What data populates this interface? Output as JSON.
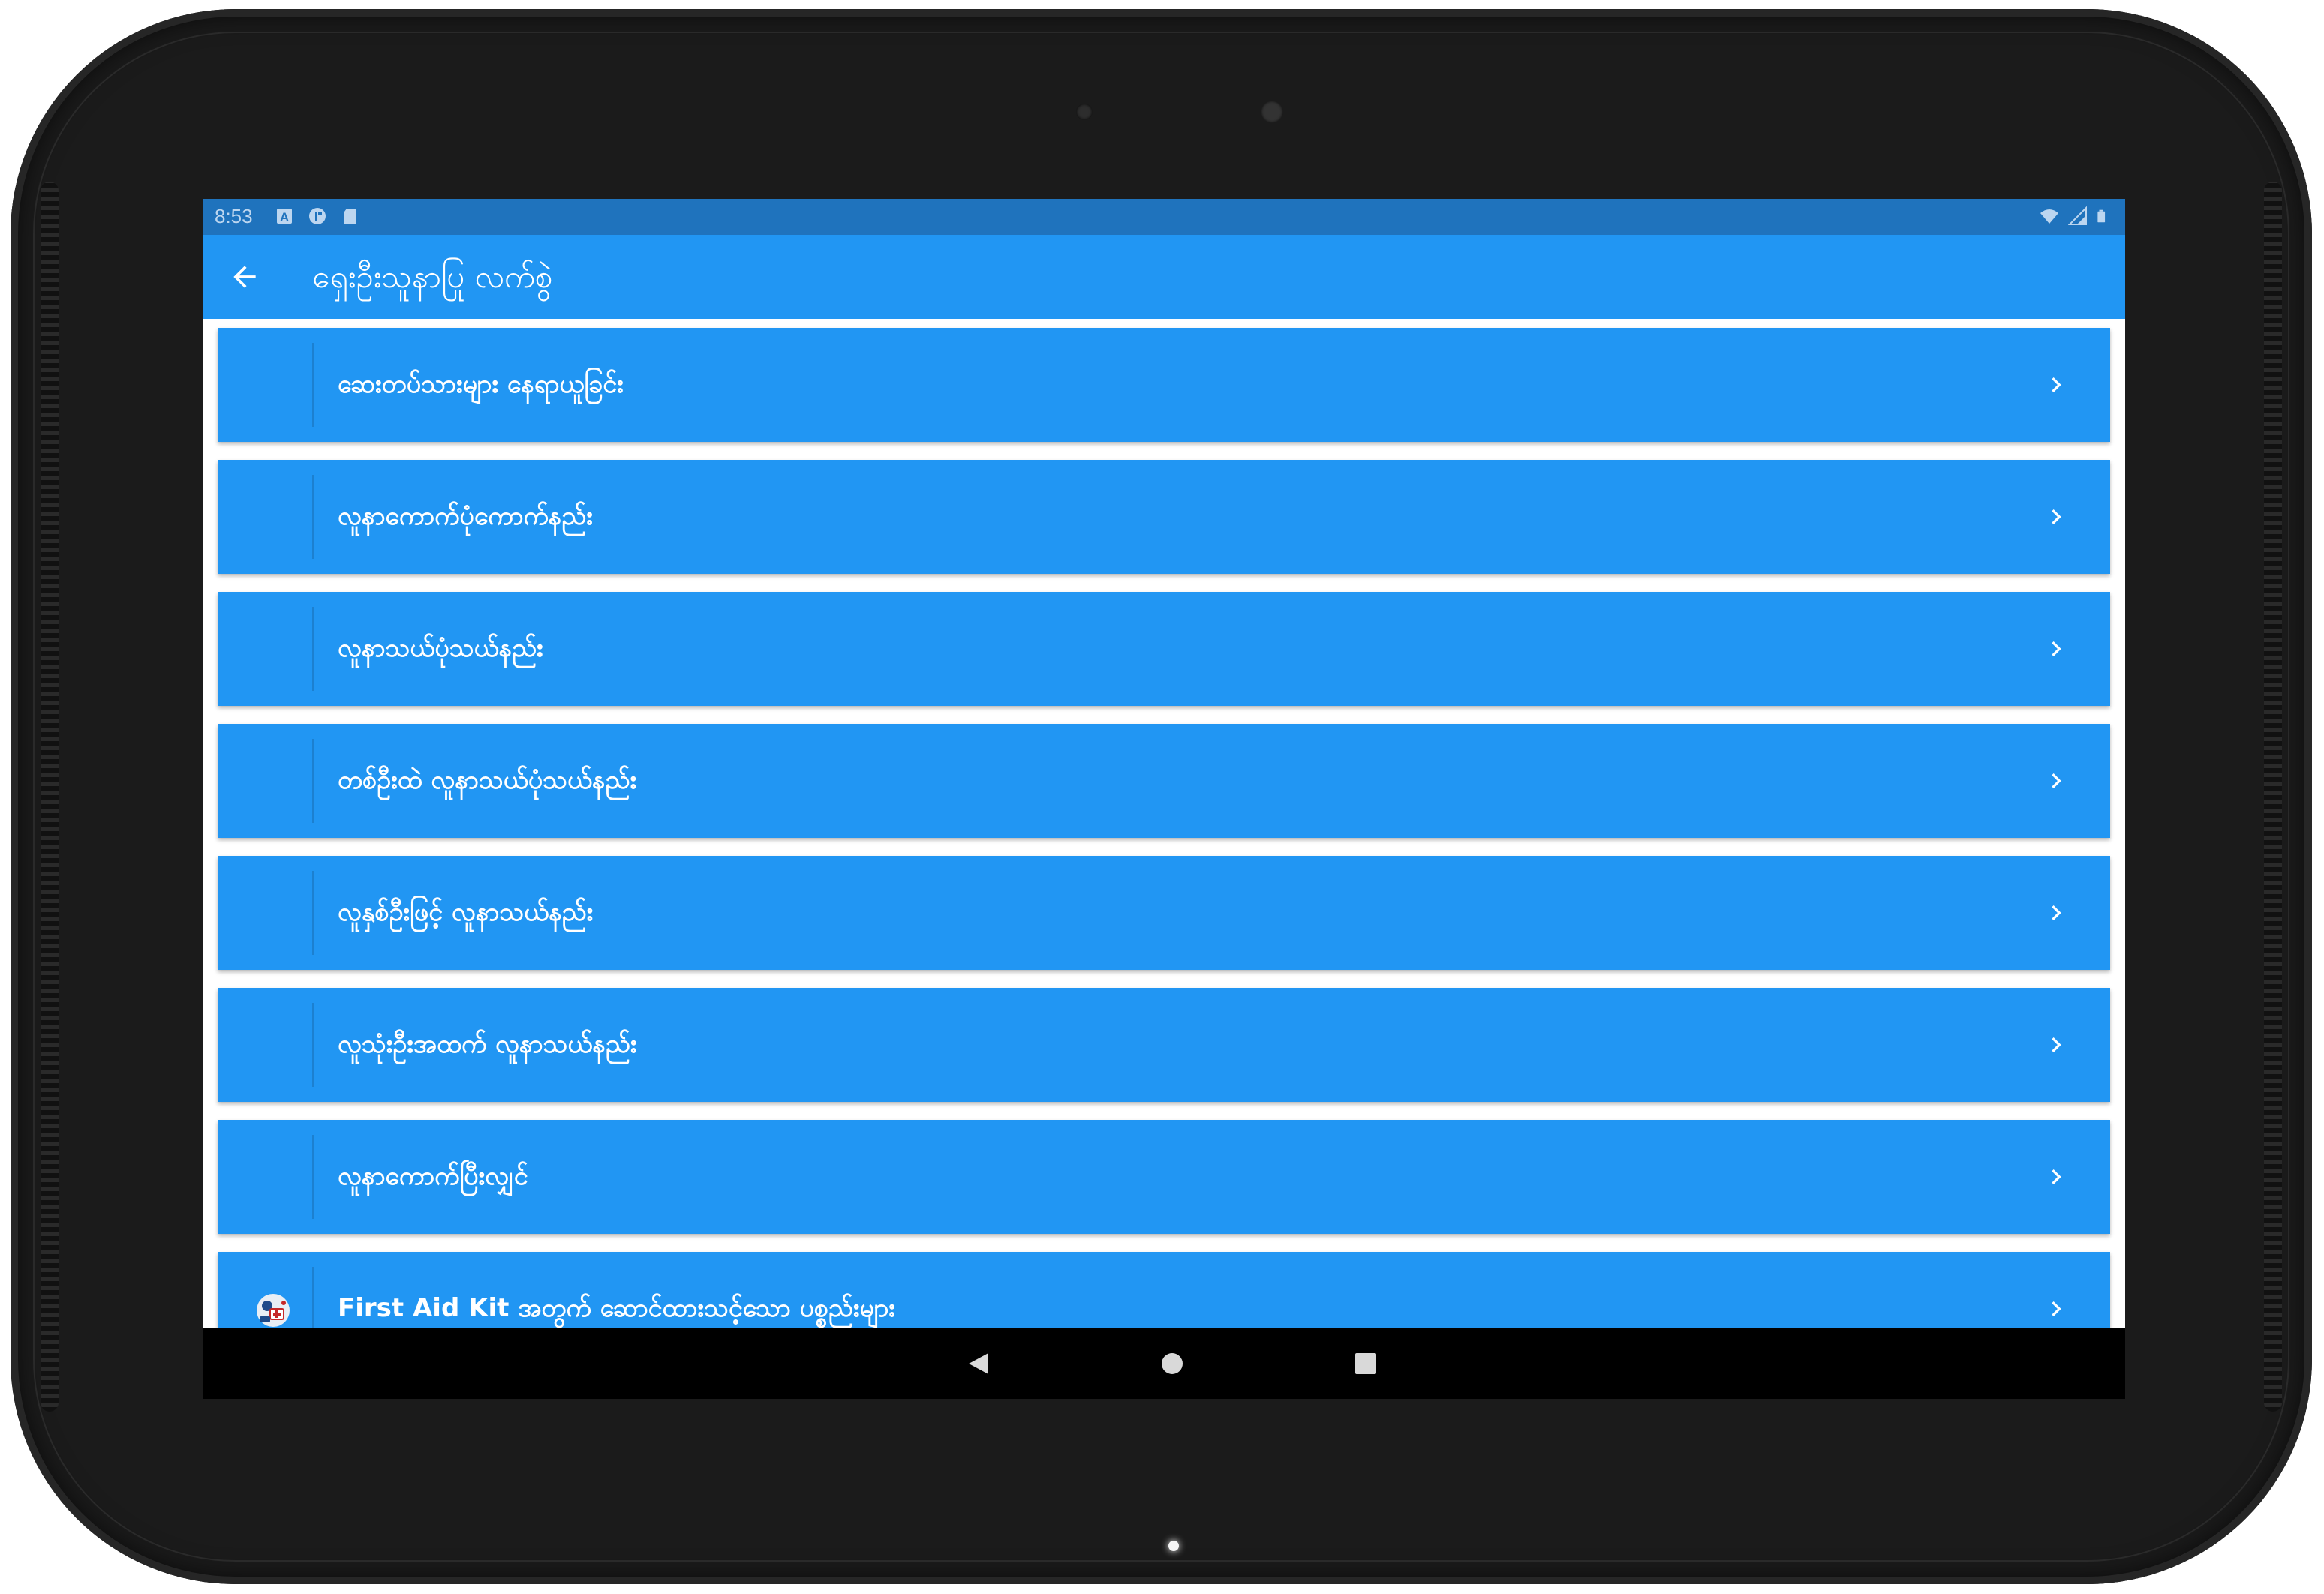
{
  "status_bar": {
    "time": "8:53",
    "left_icons": [
      "notification-a-icon",
      "app-notification-icon",
      "sd-card-icon"
    ],
    "right_icons": [
      "wifi-icon",
      "signal-icon",
      "battery-icon"
    ]
  },
  "app_bar": {
    "title": "ရှေးဦးသူနာပြု လက်စွဲ",
    "back_icon": "arrow-left-icon"
  },
  "colors": {
    "primary": "#2196f3",
    "status_bar": "#1f73bd",
    "text": "#ffffff",
    "nav_bar": "#000000"
  },
  "list": {
    "items": [
      {
        "label": "ဆေးတပ်သားများ နေရာယူခြင်း",
        "icon": ""
      },
      {
        "label": "လူနာကောက်ပုံကောက်နည်း",
        "icon": ""
      },
      {
        "label": "လူနာသယ်ပုံသယ်နည်း",
        "icon": ""
      },
      {
        "label": "တစ်ဦးထဲ လူနာသယ်ပုံသယ်နည်း",
        "icon": ""
      },
      {
        "label": "လူနှစ်ဦးဖြင့် လူနာသယ်နည်း",
        "icon": ""
      },
      {
        "label": "လူသုံးဦးအထက် လူနာသယ်နည်း",
        "icon": ""
      },
      {
        "label": "လူနာကောက်ပြီးလျှင်",
        "icon": ""
      },
      {
        "label": "First Aid Kit အတွက် ဆောင်ထားသင့်သော ပစ္စည်းများ",
        "icon": "first-aid-kit-icon"
      }
    ],
    "chevron_icon": "chevron-right-icon"
  },
  "nav_bar": {
    "buttons": [
      "back-triangle-icon",
      "home-circle-icon",
      "recents-square-icon"
    ]
  }
}
